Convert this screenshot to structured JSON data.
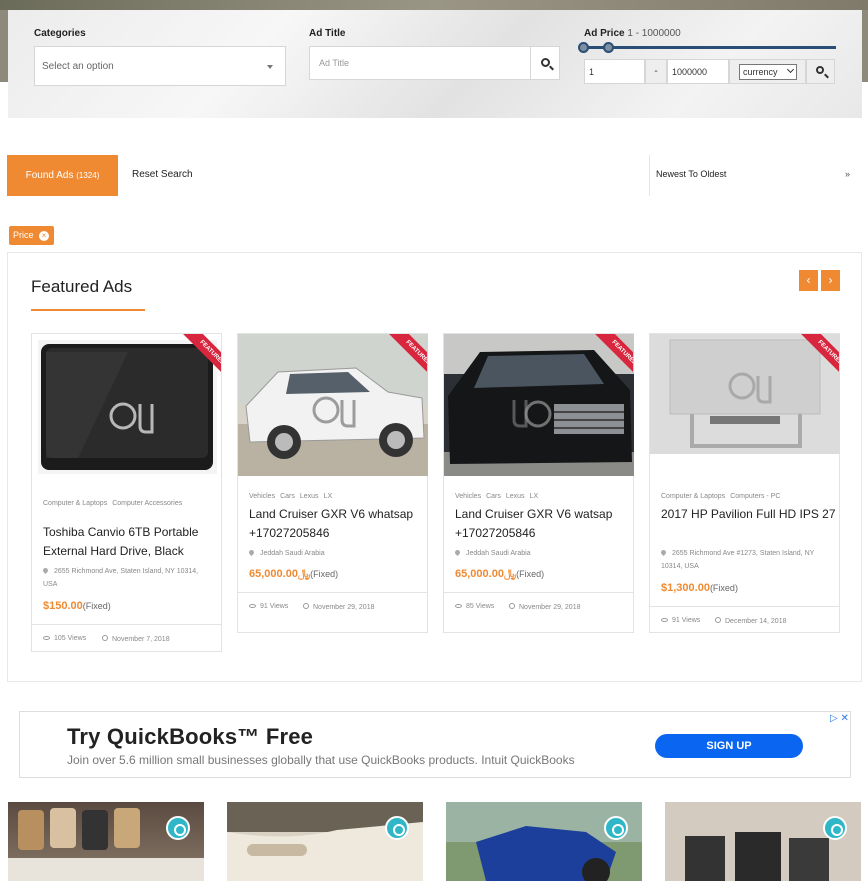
{
  "search": {
    "categories_label": "Categories",
    "categories_placeholder": "Select an option",
    "ad_title_label": "Ad Title",
    "ad_title_placeholder": "Ad Title",
    "ad_price_label": "Ad Price",
    "ad_price_range": "1 - 1000000",
    "price_min": "1",
    "price_separator": "-",
    "price_max": "1000000",
    "currency": "currency",
    "price_slider": {
      "min": 1,
      "max": 1000000,
      "from": 1,
      "to": 1000000
    }
  },
  "results": {
    "found_label": "Found Ads",
    "found_count": "(1324)",
    "reset_label": "Reset Search",
    "sort_label": "Newest To Oldest",
    "sort_icon": "»",
    "filter_chip": "Price",
    "filter_chip_close": "×"
  },
  "featured": {
    "title": "Featured Ads",
    "prev": "‹",
    "next": "›",
    "ribbon": "FEATURED",
    "cards": [
      {
        "cats": [
          "Computer & Laptops",
          "Computer Accessories"
        ],
        "title": "Toshiba Canvio 6TB Portable External Hard Drive, Black",
        "location": "2655 Richmond Ave, Staten Island, NY 10314, USA",
        "price": "$150.00",
        "price_type": "(Fixed)",
        "views": "105 Views",
        "date": "November 7, 2018"
      },
      {
        "cats": [
          "Vehicles",
          "Cars",
          "Lexus",
          "LX"
        ],
        "title": "Land Cruiser GXR V6 whatsap +17027205846",
        "location": "Jeddah Saudi Arabia",
        "price": "65,000.00﷼",
        "price_type": "(Fixed)",
        "views": "91 Views",
        "date": "November 29, 2018"
      },
      {
        "cats": [
          "Vehicles",
          "Cars",
          "Lexus",
          "LX"
        ],
        "title": "Land Cruiser GXR V6 watsap +17027205846",
        "location": "Jeddah Saudi Arabia",
        "price": "65,000.00﷼",
        "price_type": "(Fixed)",
        "views": "85 Views",
        "date": "November 29, 2018"
      },
      {
        "cats": [
          "Computer & Laptops",
          "Computers - PC"
        ],
        "title": "2017 HP Pavilion Full HD IPS 27",
        "location": "2655 Richmond Ave #1273, Staten Island, NY 10314, USA",
        "price": "$1,300.00",
        "price_type": "(Fixed)",
        "views": "91 Views",
        "date": "December 14, 2018"
      }
    ]
  },
  "ad": {
    "title": "Try QuickBooks™ Free",
    "subtitle": "Join over 5.6 million small businesses globally that use QuickBooks products. Intuit QuickBooks",
    "button": "SIGN UP",
    "adchoices": "▷ ✕"
  },
  "colors": {
    "accent": "#f08a32",
    "ribbon": "#d7263d",
    "slider": "#2a4f76",
    "ad_button": "#0a66f0"
  }
}
